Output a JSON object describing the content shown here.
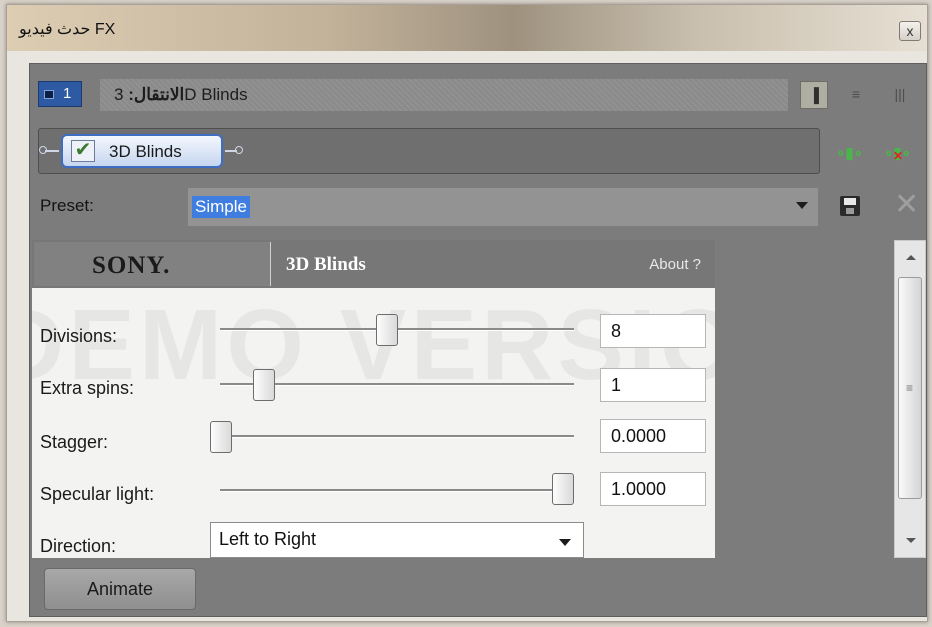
{
  "window": {
    "title": "حدث فيديو FX",
    "close_label": "x"
  },
  "track": {
    "number": "1"
  },
  "transition": {
    "label": "الانتقال:",
    "name": "3D Blinds"
  },
  "layout_buttons": [
    "▐",
    "≡",
    "|||"
  ],
  "chain": {
    "fx_name": "3D Blinds",
    "fx_checked": "✔"
  },
  "preset": {
    "label": "Preset:",
    "value": "Simple"
  },
  "plugin": {
    "brand": "SONY.",
    "title": "3D Blinds",
    "about": "About  ?",
    "watermark": "DEMO VERSION",
    "params": [
      {
        "label": "Divisions:",
        "value": "8",
        "fraction": 0.47
      },
      {
        "label": "Extra spins:",
        "value": "1",
        "fraction": 0.1
      },
      {
        "label": "Stagger:",
        "value": "0.0000",
        "fraction": 0.0
      },
      {
        "label": "Specular light:",
        "value": "1.0000",
        "fraction": 1.0
      }
    ],
    "direction": {
      "label": "Direction:",
      "value": "Left to Right"
    }
  },
  "animate_label": "Animate",
  "colors": {
    "accent": "#3f7ee0",
    "track_badge": "#2d5aa3",
    "panel_bg": "#7c7c7c"
  }
}
